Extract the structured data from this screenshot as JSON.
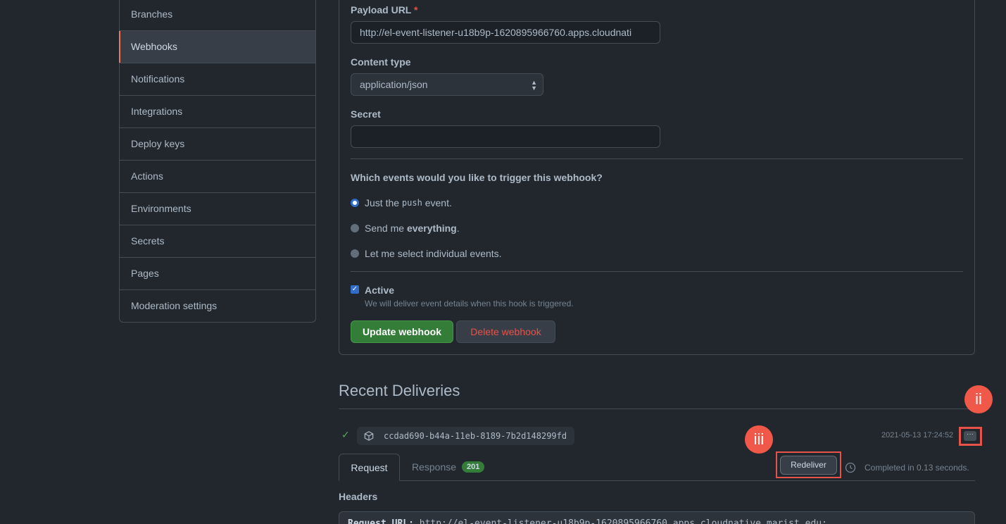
{
  "sidebar": {
    "items": [
      {
        "label": "Branches"
      },
      {
        "label": "Webhooks",
        "active": true
      },
      {
        "label": "Notifications"
      },
      {
        "label": "Integrations"
      },
      {
        "label": "Deploy keys"
      },
      {
        "label": "Actions"
      },
      {
        "label": "Environments"
      },
      {
        "label": "Secrets"
      },
      {
        "label": "Pages"
      },
      {
        "label": "Moderation settings"
      }
    ]
  },
  "form": {
    "payload_url_label": "Payload URL",
    "required_marker": "*",
    "payload_url_value": "http://el-event-listener-u18b9p-1620895966760.apps.cloudnati",
    "content_type_label": "Content type",
    "content_type_value": "application/json",
    "secret_label": "Secret",
    "secret_value": "",
    "events_question": "Which events would you like to trigger this webhook?",
    "radio_push_pre": "Just the",
    "radio_push_code": "push",
    "radio_push_post": "event.",
    "radio_everything_pre": "Send me",
    "radio_everything_bold": "everything",
    "radio_everything_post": ".",
    "radio_individual": "Let me select individual events.",
    "selected_event_option": "push",
    "active_label": "Active",
    "active_checked": true,
    "active_hint": "We will deliver event details when this hook is triggered.",
    "update_button": "Update webhook",
    "delete_button": "Delete webhook"
  },
  "deliveries": {
    "title": "Recent Deliveries",
    "guid": "ccdad690-b44a-11eb-8189-7b2d148299fd",
    "timestamp": "2021-05-13 17:24:52",
    "more_label": "···",
    "tab_request": "Request",
    "tab_response": "Response",
    "response_code": "201",
    "redeliver_button": "Redeliver",
    "completed_text": "Completed in 0.13 seconds.",
    "headers_label": "Headers",
    "request_url_label": "Request URL:",
    "request_url_value": "http://el-event-listener-u18b9p-1620895966760.apps.cloudnative.marist.edu:"
  },
  "annotations": {
    "marker_ii": "ii",
    "marker_iii": "iii"
  },
  "colors": {
    "background": "#22272e",
    "accent_active": "#ec775c",
    "primary_button": "#347d39",
    "danger": "#e5534b",
    "annotation_red": "#f0584a"
  }
}
